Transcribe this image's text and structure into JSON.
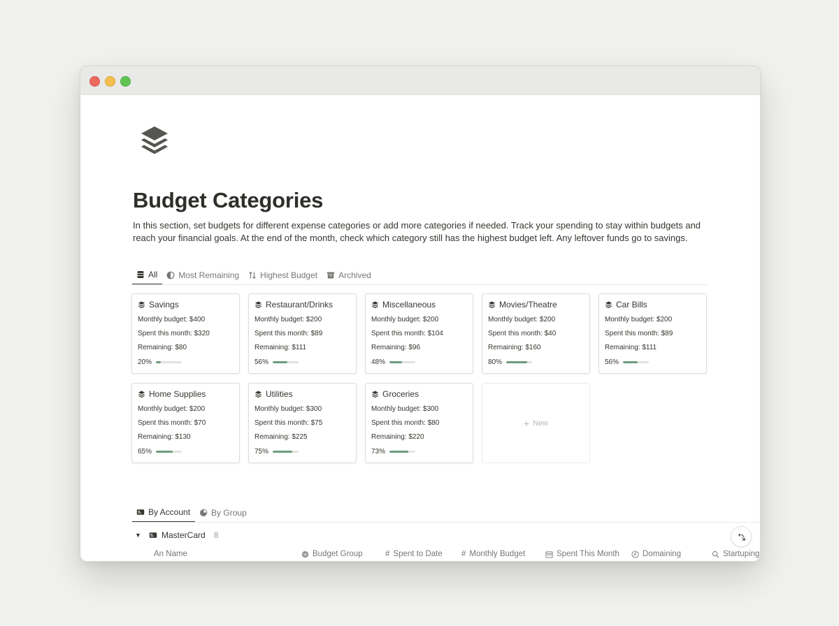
{
  "page": {
    "icon": "stacked-layers-icon",
    "title": "Budget Categories",
    "description": "In this section, set budgets for different expense categories or add more categories if needed. Track your spending to stay within budgets and reach your financial goals. At the end of the month, check which category still has the highest budget left. Any leftover funds go to savings."
  },
  "view_tabs": [
    {
      "label": "All",
      "icon": "database-icon",
      "active": true
    },
    {
      "label": "Most Remaining",
      "icon": "half-circle-icon",
      "active": false
    },
    {
      "label": "Highest Budget",
      "icon": "sort-arrows-icon",
      "active": false
    },
    {
      "label": "Archived",
      "icon": "archive-icon",
      "active": false
    }
  ],
  "cards": [
    {
      "name": "Savings",
      "budget": "Monthly budget: $400",
      "spent": "Spent this month: $320",
      "remaining": "Remaining: $80",
      "percent_label": "20%",
      "progress": 0.2
    },
    {
      "name": "Restaurant/Drinks",
      "budget": "Monthly budget: $200",
      "spent": "Spent this month: $89",
      "remaining": "Remaining: $111",
      "percent_label": "56%",
      "progress": 0.56
    },
    {
      "name": "Miscellaneous",
      "budget": "Monthly budget: $200",
      "spent": "Spent this month: $104",
      "remaining": "Remaining: $96",
      "percent_label": "48%",
      "progress": 0.48
    },
    {
      "name": "Movies/Theatre",
      "budget": "Monthly budget: $200",
      "spent": "Spent this month: $40",
      "remaining": "Remaining: $160",
      "percent_label": "80%",
      "progress": 0.8
    },
    {
      "name": "Car Bills",
      "budget": "Monthly budget: $200",
      "spent": "Spent this month: $89",
      "remaining": "Remaining: $111",
      "percent_label": "56%",
      "progress": 0.56
    },
    {
      "name": "Home Supplies",
      "budget": "Monthly budget: $200",
      "spent": "Spent this month: $70",
      "remaining": "Remaining: $130",
      "percent_label": "65%",
      "progress": 0.65
    },
    {
      "name": "Utilities",
      "budget": "Monthly budget: $300",
      "spent": "Spent this month: $75",
      "remaining": "Remaining: $225",
      "percent_label": "75%",
      "progress": 0.75
    },
    {
      "name": "Groceries",
      "budget": "Monthly budget: $300",
      "spent": "Spent this month: $80",
      "remaining": "Remaining: $220",
      "percent_label": "73%",
      "progress": 0.73
    }
  ],
  "new_card": {
    "label": "New"
  },
  "account_tabs": [
    {
      "label": "By Account",
      "icon": "card-icon",
      "active": true
    },
    {
      "label": "By Group",
      "icon": "pie-icon",
      "active": false
    }
  ],
  "group": {
    "name": "MasterCard",
    "count": "8",
    "icon": "card-icon"
  },
  "columns": [
    {
      "label": "An Name",
      "icon": ""
    },
    {
      "label": "Budget Group",
      "icon": "select-icon"
    },
    {
      "label": "Spent to Date",
      "icon": "hash-icon"
    },
    {
      "label": "Monthly Budget",
      "icon": "hash-icon"
    },
    {
      "label": "Spent This Month",
      "icon": "calendar-icon"
    },
    {
      "label": "Domaining",
      "icon": "formula-icon"
    },
    {
      "label": "Startuping",
      "icon": "search-icon"
    }
  ],
  "colors": {
    "progress": "#6c9b7d",
    "text": "#37352f",
    "muted": "#787774"
  }
}
